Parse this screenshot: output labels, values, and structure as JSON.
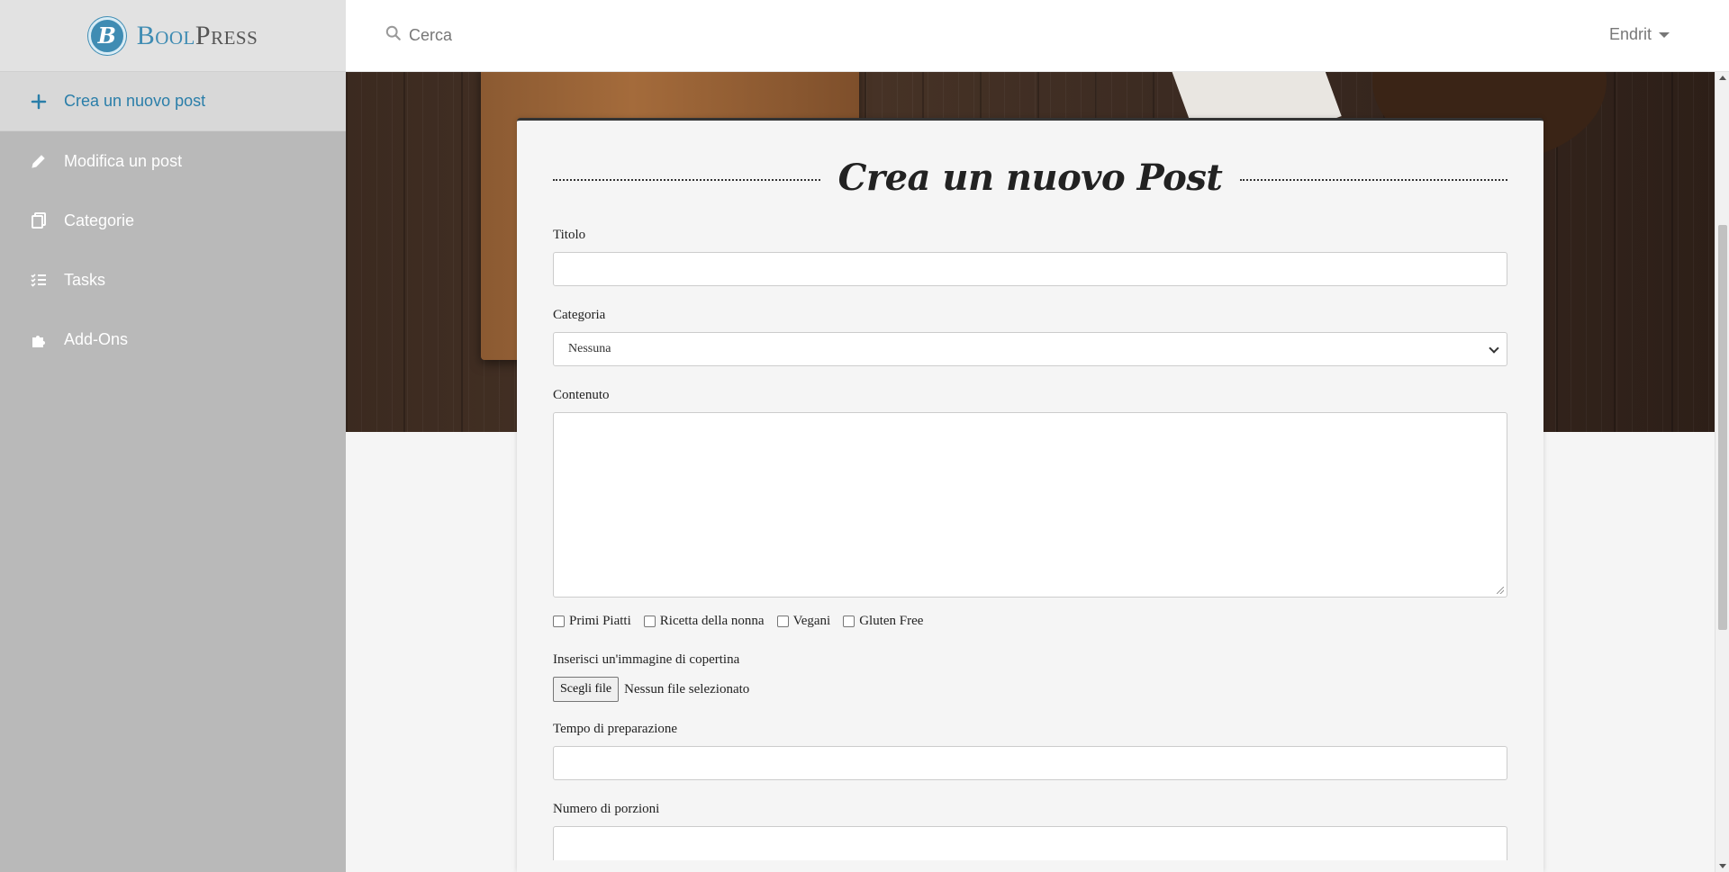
{
  "brand": {
    "logo_letter": "B",
    "name_part1": "Bool",
    "name_part2": "Press"
  },
  "sidebar": {
    "items": [
      {
        "label": "Crea un nuovo post",
        "icon": "plus-icon"
      },
      {
        "label": "Modifica un post",
        "icon": "pencil-icon"
      },
      {
        "label": "Categorie",
        "icon": "copy-icon"
      },
      {
        "label": "Tasks",
        "icon": "tasks-icon"
      },
      {
        "label": "Add-Ons",
        "icon": "puzzle-icon"
      }
    ]
  },
  "topbar": {
    "search_label": "Cerca",
    "user_name": "Endrit"
  },
  "form": {
    "title": "Crea un nuovo Post",
    "title_label": "Titolo",
    "category_label": "Categoria",
    "category_selected": "Nessuna",
    "content_label": "Contenuto",
    "tags": [
      "Primi Piatti",
      "Ricetta della nonna",
      "Vegani",
      "Gluten Free"
    ],
    "cover_label": "Inserisci un'immagine di copertina",
    "file_button": "Scegli file",
    "file_status": "Nessun file selezionato",
    "prep_time_label": "Tempo di preparazione",
    "portions_label": "Numero di porzioni"
  },
  "colors": {
    "accent": "#3f8cb3",
    "sidebar_bg": "#b9b9b9",
    "active_text": "#2a7ea9"
  }
}
